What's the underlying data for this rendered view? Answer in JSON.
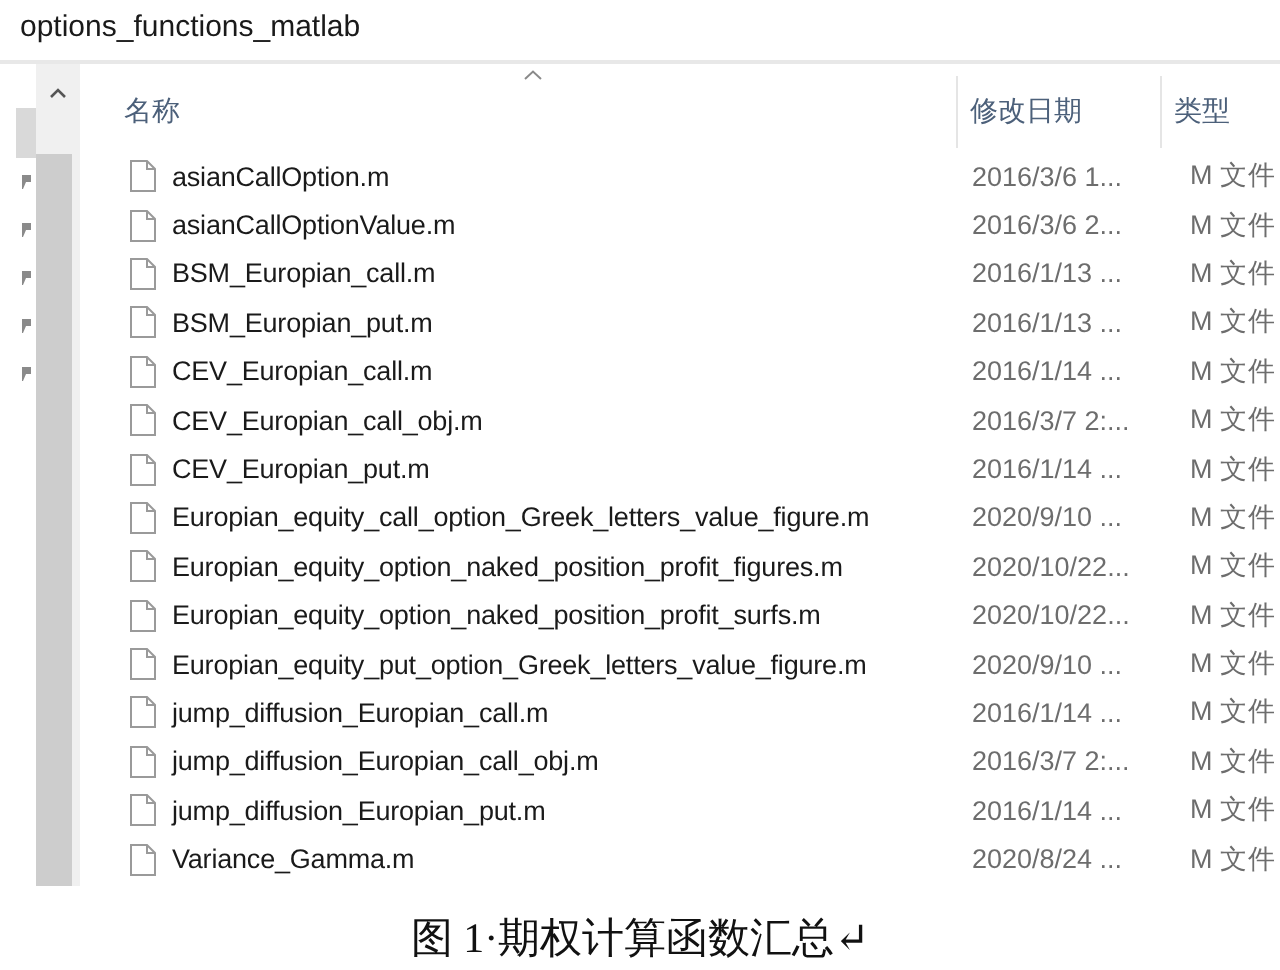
{
  "window": {
    "title": "options_functions_matlab"
  },
  "columns": [
    {
      "label": "名称",
      "sorted": true
    },
    {
      "label": "修改日期",
      "sorted": false
    },
    {
      "label": "类型",
      "sorted": false
    }
  ],
  "files": [
    {
      "name": "asianCallOption.m",
      "modified": "2016/3/6 1...",
      "type": "M 文件"
    },
    {
      "name": "asianCallOptionValue.m",
      "modified": "2016/3/6 2...",
      "type": "M 文件"
    },
    {
      "name": "BSM_Europian_call.m",
      "modified": "2016/1/13 ...",
      "type": "M 文件"
    },
    {
      "name": "BSM_Europian_put.m",
      "modified": "2016/1/13 ...",
      "type": "M 文件"
    },
    {
      "name": "CEV_Europian_call.m",
      "modified": "2016/1/14 ...",
      "type": "M 文件"
    },
    {
      "name": "CEV_Europian_call_obj.m",
      "modified": "2016/3/7 2:...",
      "type": "M 文件"
    },
    {
      "name": "CEV_Europian_put.m",
      "modified": "2016/1/14 ...",
      "type": "M 文件"
    },
    {
      "name": "Europian_equity_call_option_Greek_letters_value_figure.m",
      "modified": "2020/9/10 ...",
      "type": "M 文件"
    },
    {
      "name": "Europian_equity_option_naked_position_profit_figures.m",
      "modified": "2020/10/22...",
      "type": "M 文件"
    },
    {
      "name": "Europian_equity_option_naked_position_profit_surfs.m",
      "modified": "2020/10/22...",
      "type": "M 文件"
    },
    {
      "name": "Europian_equity_put_option_Greek_letters_value_figure.m",
      "modified": "2020/9/10 ...",
      "type": "M 文件"
    },
    {
      "name": "jump_diffusion_Europian_call.m",
      "modified": "2016/1/14 ...",
      "type": "M 文件"
    },
    {
      "name": "jump_diffusion_Europian_call_obj.m",
      "modified": "2016/3/7 2:...",
      "type": "M 文件"
    },
    {
      "name": "jump_diffusion_Europian_put.m",
      "modified": "2016/1/14 ...",
      "type": "M 文件"
    },
    {
      "name": "Variance_Gamma.m",
      "modified": "2020/8/24 ...",
      "type": "M 文件"
    }
  ],
  "caption": "图 1·期权计算函数汇总↵"
}
